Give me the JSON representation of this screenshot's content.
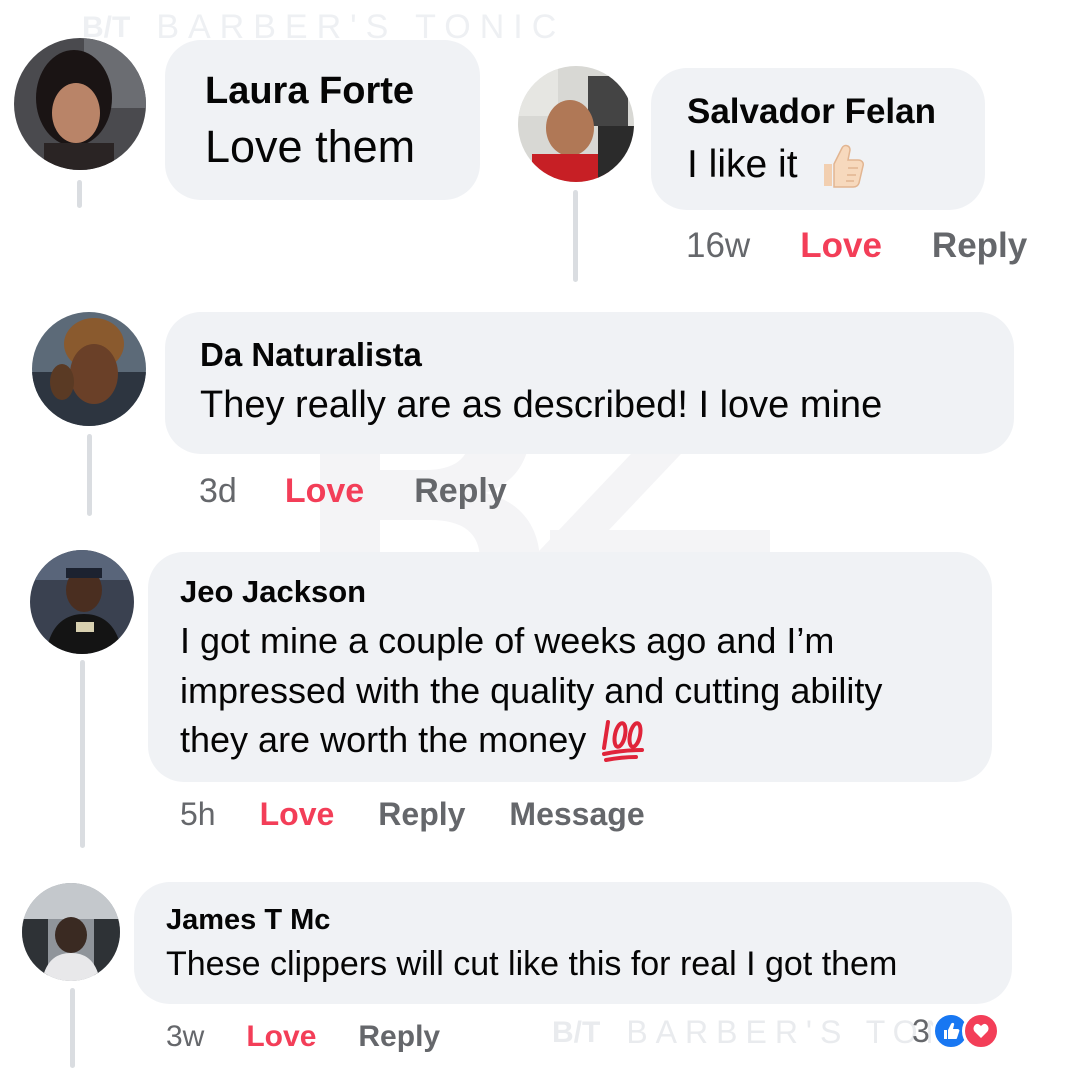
{
  "watermark": {
    "logo": "B/T",
    "brand": "BARBER'S TONIC"
  },
  "comments": [
    {
      "author": "Laura Forte",
      "text": "Love them"
    },
    {
      "author": "Salvador Felan",
      "text": "I like it",
      "emoji": "thumbs-up",
      "time": "16w",
      "love": "Love",
      "reply": "Reply"
    },
    {
      "author": "Da Naturalista",
      "text": "They really are as described! I love mine",
      "time": "3d",
      "love": "Love",
      "reply": "Reply"
    },
    {
      "author": "Jeo Jackson",
      "lines": [
        "I got mine a couple of weeks ago and I’m",
        "impressed with the quality and cutting ability",
        "they are worth the money"
      ],
      "emoji": "hundred-points",
      "time": "5h",
      "love": "Love",
      "reply": "Reply",
      "message": "Message"
    },
    {
      "author": "James T Mc",
      "text": "These clippers will cut like this for real I got them",
      "time": "3w",
      "love": "Love",
      "reply": "Reply",
      "reaction_count": "3",
      "reactions": [
        "like",
        "love"
      ]
    }
  ],
  "colors": {
    "bubble": "#f0f2f5",
    "love_accent": "#f33e58",
    "secondary_text": "#65676b",
    "like_blue": "#1877f2"
  }
}
